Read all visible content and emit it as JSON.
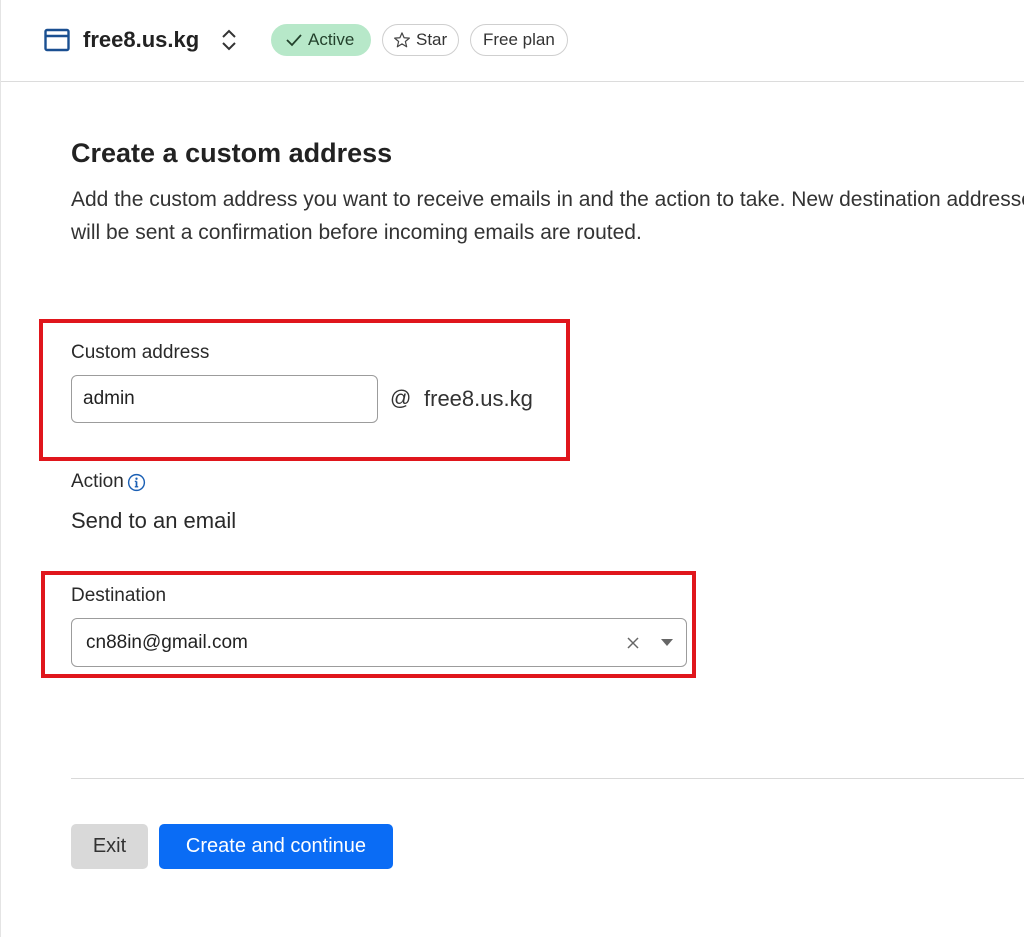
{
  "header": {
    "site_name": "free8.us.kg",
    "status_label": "Active",
    "star_label": "Star",
    "plan_label": "Free plan"
  },
  "section": {
    "title": "Create a custom address",
    "description": "Add the custom address you want to receive emails in and the action to take. New destination addresses will be sent a confirmation before incoming emails are routed."
  },
  "form": {
    "custom_address": {
      "label": "Custom address",
      "value": "admin",
      "at_symbol": "@",
      "domain": "free8.us.kg"
    },
    "action": {
      "label": "Action",
      "value": "Send to an email"
    },
    "destination": {
      "label": "Destination",
      "value": "cn88in@gmail.com"
    }
  },
  "buttons": {
    "exit_label": "Exit",
    "create_label": "Create and continue"
  },
  "colors": {
    "active_badge_bg": "#b7e8c9",
    "primary_button": "#0a6cf5",
    "highlight": "#e0161c",
    "icon_blue": "#1a4f91"
  },
  "icons": {
    "site": "browser-window-icon",
    "switcher": "chevron-up-down-icon",
    "active": "checkmark-icon",
    "star": "star-icon",
    "info": "info-icon",
    "clear": "close-icon",
    "dropdown": "caret-down-icon"
  }
}
